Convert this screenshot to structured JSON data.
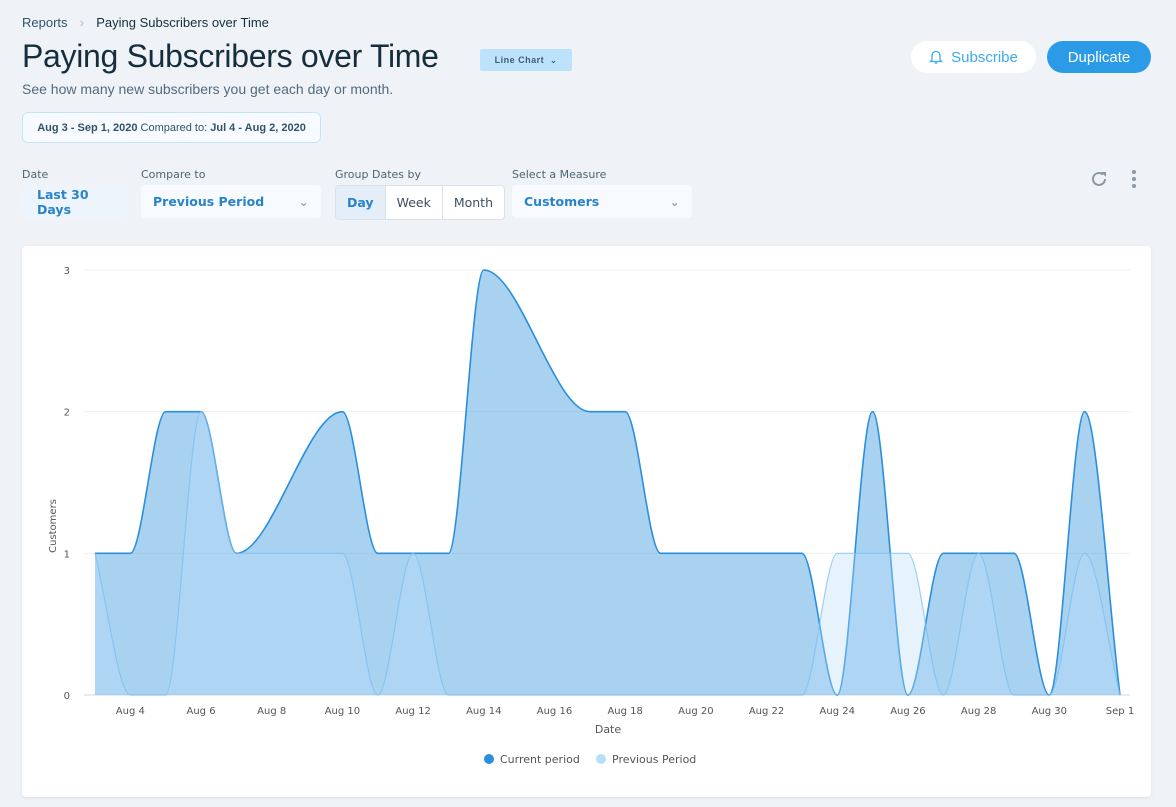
{
  "breadcrumb": {
    "root": "Reports",
    "current": "Paying Subscribers over Time"
  },
  "header": {
    "title": "Paying Subscribers over Time",
    "chart_type_label": "Line Chart",
    "subtitle": "See how many new subscribers you get each day or month.",
    "subscribe_label": "Subscribe",
    "duplicate_label": "Duplicate"
  },
  "date_range": {
    "current": "Aug 3 - Sep 1, 2020",
    "compared_label": "Compared to:",
    "previous": "Jul 4 - Aug 2, 2020"
  },
  "filters": {
    "date": {
      "label": "Date",
      "value": "Last 30 Days"
    },
    "compare": {
      "label": "Compare to",
      "value": "Previous Period"
    },
    "group": {
      "label": "Group Dates by",
      "options": [
        "Day",
        "Week",
        "Month"
      ],
      "selected": "Day"
    },
    "measure": {
      "label": "Select a Measure",
      "value": "Customers"
    }
  },
  "icons": {
    "subscribe": "bell-icon",
    "refresh": "refresh-icon",
    "more": "more-vertical-icon"
  },
  "colors": {
    "current": "#2a8fdc",
    "previous": "#b7defa",
    "accent": "#2b9be8"
  },
  "chart_data": {
    "type": "area",
    "xlabel": "Date",
    "ylabel": "Customers",
    "ylim": [
      0,
      3
    ],
    "yticks": [
      0,
      1,
      2,
      3
    ],
    "grid": true,
    "legend_position": "bottom",
    "xticks": [
      "Aug 4",
      "Aug 6",
      "Aug 8",
      "Aug 10",
      "Aug 12",
      "Aug 14",
      "Aug 16",
      "Aug 18",
      "Aug 20",
      "Aug 22",
      "Aug 24",
      "Aug 26",
      "Aug 28",
      "Aug 30",
      "Sep 1"
    ],
    "series": [
      {
        "name": "Current period",
        "points": [
          [
            "Aug 3",
            1
          ],
          [
            "Aug 4",
            1
          ],
          [
            "Aug 5",
            2
          ],
          [
            "Aug 6",
            2
          ],
          [
            "Aug 7",
            1
          ],
          [
            "Aug 10",
            2
          ],
          [
            "Aug 11",
            1
          ],
          [
            "Aug 12",
            1
          ],
          [
            "Aug 13",
            1
          ],
          [
            "Aug 14",
            3
          ],
          [
            "Aug 17",
            2
          ],
          [
            "Aug 18",
            2
          ],
          [
            "Aug 19",
            1
          ],
          [
            "Aug 20",
            1
          ],
          [
            "Aug 21",
            1
          ],
          [
            "Aug 22",
            1
          ],
          [
            "Aug 23",
            1
          ],
          [
            "Aug 24",
            0
          ],
          [
            "Aug 25",
            2
          ],
          [
            "Aug 26",
            0
          ],
          [
            "Aug 27",
            1
          ],
          [
            "Aug 28",
            1
          ],
          [
            "Aug 29",
            1
          ],
          [
            "Aug 30",
            0
          ],
          [
            "Aug 31",
            2
          ],
          [
            "Sep 1",
            0
          ]
        ]
      },
      {
        "name": "Previous Period",
        "points": [
          [
            "Aug 3",
            1
          ],
          [
            "Aug 4",
            0
          ],
          [
            "Aug 5",
            0
          ],
          [
            "Aug 6",
            2
          ],
          [
            "Aug 7",
            1
          ],
          [
            "Aug 8",
            1
          ],
          [
            "Aug 9",
            1
          ],
          [
            "Aug 10",
            1
          ],
          [
            "Aug 11",
            0
          ],
          [
            "Aug 12",
            1
          ],
          [
            "Aug 13",
            0
          ],
          [
            "Aug 14",
            0
          ],
          [
            "Aug 15",
            0
          ],
          [
            "Aug 16",
            0
          ],
          [
            "Aug 17",
            0
          ],
          [
            "Aug 18",
            0
          ],
          [
            "Aug 19",
            0
          ],
          [
            "Aug 20",
            0
          ],
          [
            "Aug 21",
            0
          ],
          [
            "Aug 22",
            0
          ],
          [
            "Aug 23",
            0
          ],
          [
            "Aug 24",
            1
          ],
          [
            "Aug 25",
            1
          ],
          [
            "Aug 26",
            1
          ],
          [
            "Aug 27",
            0
          ],
          [
            "Aug 28",
            1
          ],
          [
            "Aug 29",
            0
          ],
          [
            "Aug 30",
            0
          ],
          [
            "Aug 31",
            1
          ],
          [
            "Sep 1",
            0
          ]
        ]
      }
    ]
  }
}
